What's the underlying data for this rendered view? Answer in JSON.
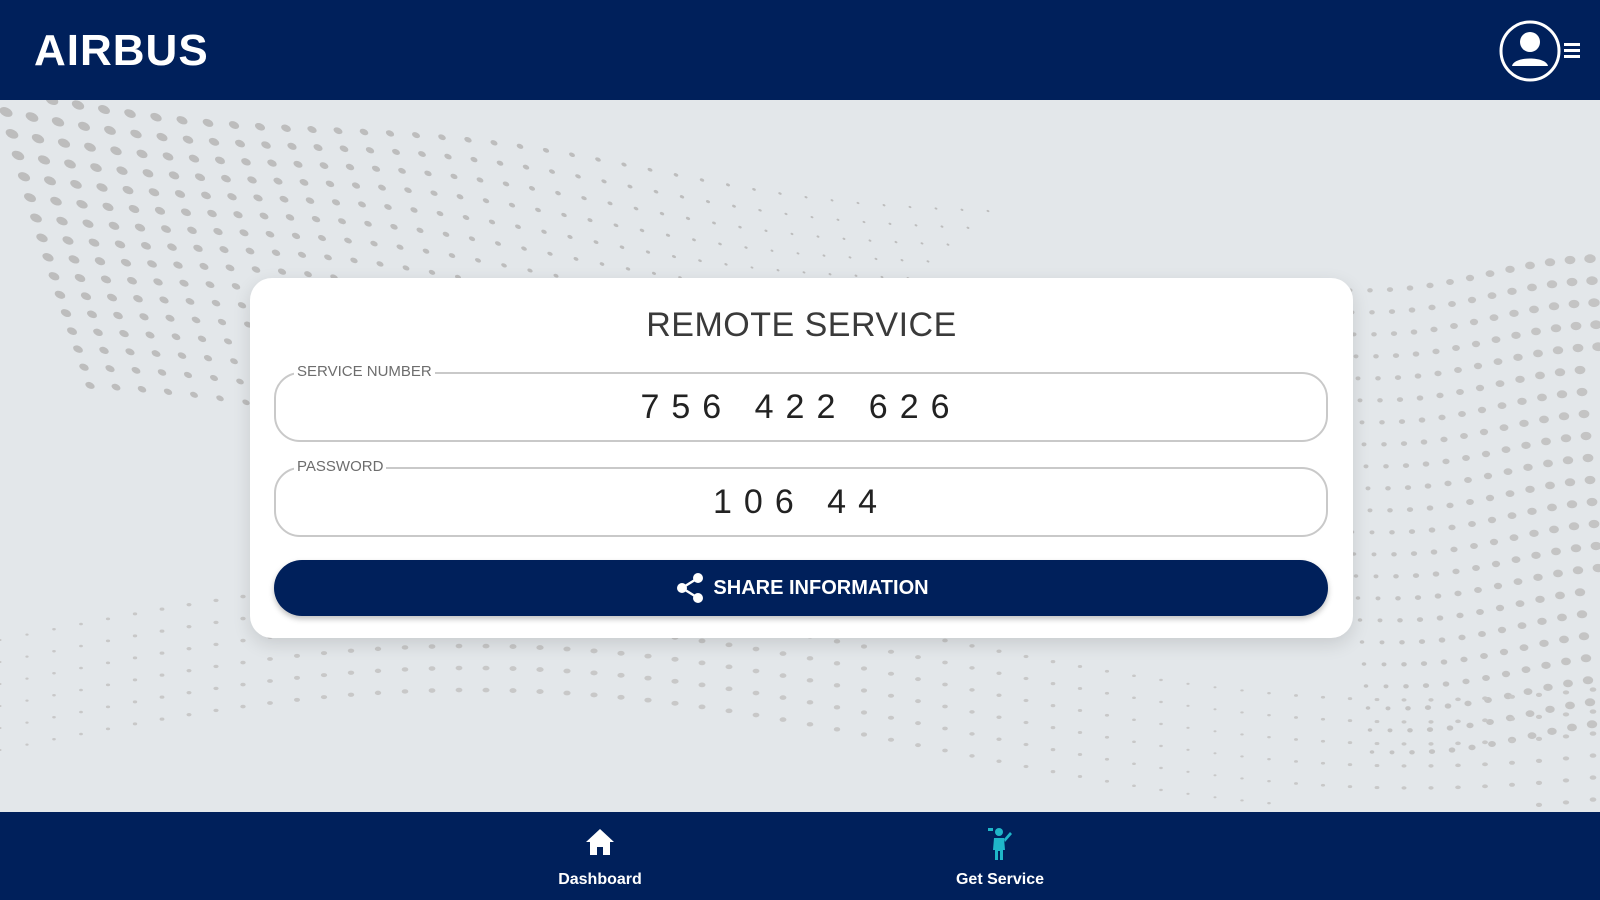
{
  "header": {
    "logo_text": "AIRBUS",
    "user_icon": "user-circle-icon",
    "menu_icon": "hamburger-menu-icon"
  },
  "card": {
    "title": "REMOTE SERVICE",
    "service_number": {
      "label": "SERVICE NUMBER",
      "value": "756 422 626"
    },
    "password": {
      "label": "PASSWORD",
      "value": "106 44"
    },
    "share_button": {
      "label": "SHARE INFORMATION",
      "icon": "share-icon"
    }
  },
  "bottom_nav": {
    "items": [
      {
        "label": "Dashboard",
        "icon": "home-icon"
      },
      {
        "label": "Get Service",
        "icon": "service-person-icon"
      }
    ]
  },
  "colors": {
    "brand_navy": "#00205b",
    "background": "#e3e7ea",
    "card": "#ffffff",
    "service_icon_teal": "#1fb6c9"
  }
}
